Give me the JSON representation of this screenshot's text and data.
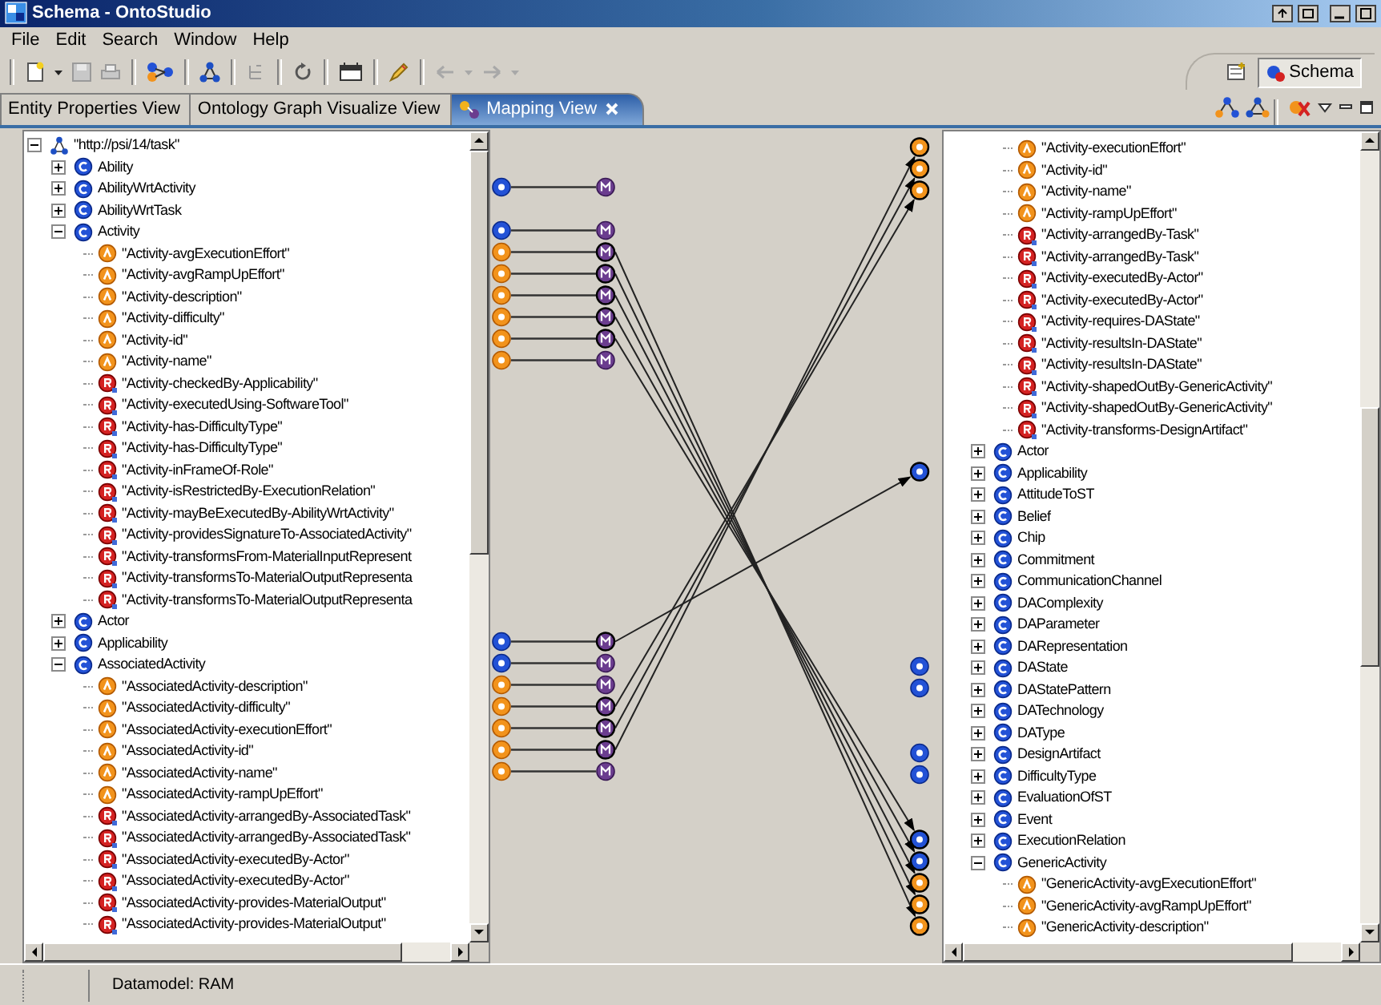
{
  "window": {
    "title": "Schema - OntoStudio"
  },
  "menu": [
    "File",
    "Edit",
    "Search",
    "Window",
    "Help"
  ],
  "perspective": {
    "label": "Schema",
    "selected": true
  },
  "tabs": [
    {
      "label": "Entity Properties View",
      "selected": false,
      "has_icon": false,
      "closable": false
    },
    {
      "label": "Ontology Graph Visualize View",
      "selected": false,
      "has_icon": false,
      "closable": false
    },
    {
      "label": "Mapping View",
      "selected": true,
      "has_icon": true,
      "closable": true
    }
  ],
  "source_tree": {
    "root": {
      "label": "\"http://psi/14/task\"",
      "kind": "ontology",
      "expanded": true,
      "children": [
        {
          "label": "Ability",
          "kind": "class",
          "expanded": false
        },
        {
          "label": "AbilityWrtActivity",
          "kind": "class",
          "expanded": false,
          "mapped": true
        },
        {
          "label": "AbilityWrtTask",
          "kind": "class",
          "expanded": false
        },
        {
          "label": "Activity",
          "kind": "class",
          "expanded": true,
          "mapped": true,
          "children": [
            {
              "label": "\"Activity-avgExecutionEffort\"",
              "kind": "attribute",
              "mapped": true,
              "arrow": true
            },
            {
              "label": "\"Activity-avgRampUpEffort\"",
              "kind": "attribute",
              "mapped": true,
              "arrow": true
            },
            {
              "label": "\"Activity-description\"",
              "kind": "attribute",
              "mapped": true,
              "arrow": true
            },
            {
              "label": "\"Activity-difficulty\"",
              "kind": "attribute",
              "mapped": true,
              "arrow": true
            },
            {
              "label": "\"Activity-id\"",
              "kind": "attribute",
              "mapped": true,
              "arrow": true
            },
            {
              "label": "\"Activity-name\"",
              "kind": "attribute",
              "mapped": true,
              "arrow": false
            },
            {
              "label": "\"Activity-checkedBy-Applicability\"",
              "kind": "relation"
            },
            {
              "label": "\"Activity-executedUsing-SoftwareTool\"",
              "kind": "relation"
            },
            {
              "label": "\"Activity-has-DifficultyType\"",
              "kind": "relation"
            },
            {
              "label": "\"Activity-has-DifficultyType\"",
              "kind": "relation"
            },
            {
              "label": "\"Activity-inFrameOf-Role\"",
              "kind": "relation"
            },
            {
              "label": "\"Activity-isRestrictedBy-ExecutionRelation\"",
              "kind": "relation"
            },
            {
              "label": "\"Activity-mayBeExecutedBy-AbilityWrtActivity\"",
              "kind": "relation"
            },
            {
              "label": "\"Activity-providesSignatureTo-AssociatedActivity\"",
              "kind": "relation"
            },
            {
              "label": "\"Activity-transformsFrom-MaterialInputRepresent",
              "kind": "relation"
            },
            {
              "label": "\"Activity-transformsTo-MaterialOutputRepresenta",
              "kind": "relation"
            },
            {
              "label": "\"Activity-transformsTo-MaterialOutputRepresenta",
              "kind": "relation"
            }
          ]
        },
        {
          "label": "Actor",
          "kind": "class",
          "expanded": false
        },
        {
          "label": "Applicability",
          "kind": "class",
          "expanded": false,
          "mapped": true,
          "arrow": true
        },
        {
          "label": "AssociatedActivity",
          "kind": "class",
          "expanded": true,
          "mapped": true,
          "children": [
            {
              "label": "\"AssociatedActivity-description\"",
              "kind": "attribute",
              "mapped": true
            },
            {
              "label": "\"AssociatedActivity-difficulty\"",
              "kind": "attribute",
              "mapped": true,
              "arrow": true
            },
            {
              "label": "\"AssociatedActivity-executionEffort\"",
              "kind": "attribute",
              "mapped": true,
              "arrow": true
            },
            {
              "label": "\"AssociatedActivity-id\"",
              "kind": "attribute",
              "mapped": true,
              "arrow": true
            },
            {
              "label": "\"AssociatedActivity-name\"",
              "kind": "attribute",
              "mapped": true
            },
            {
              "label": "\"AssociatedActivity-rampUpEffort\"",
              "kind": "attribute"
            },
            {
              "label": "\"AssociatedActivity-arrangedBy-AssociatedTask\"",
              "kind": "relation"
            },
            {
              "label": "\"AssociatedActivity-arrangedBy-AssociatedTask\"",
              "kind": "relation"
            },
            {
              "label": "\"AssociatedActivity-executedBy-Actor\"",
              "kind": "relation"
            },
            {
              "label": "\"AssociatedActivity-executedBy-Actor\"",
              "kind": "relation"
            },
            {
              "label": "\"AssociatedActivity-provides-MaterialOutput\"",
              "kind": "relation"
            },
            {
              "label": "\"AssociatedActivity-provides-MaterialOutput\"",
              "kind": "relation"
            }
          ]
        }
      ]
    }
  },
  "target_tree": {
    "continued_children": [
      {
        "label": "\"Activity-executionEffort\"",
        "kind": "attribute",
        "mapped": true,
        "arrow_in": true
      },
      {
        "label": "\"Activity-id\"",
        "kind": "attribute",
        "mapped": true,
        "arrow_in": true
      },
      {
        "label": "\"Activity-name\"",
        "kind": "attribute",
        "mapped": true,
        "arrow_in": true
      },
      {
        "label": "\"Activity-rampUpEffort\"",
        "kind": "attribute"
      },
      {
        "label": "\"Activity-arrangedBy-Task\"",
        "kind": "relation"
      },
      {
        "label": "\"Activity-arrangedBy-Task\"",
        "kind": "relation"
      },
      {
        "label": "\"Activity-executedBy-Actor\"",
        "kind": "relation"
      },
      {
        "label": "\"Activity-executedBy-Actor\"",
        "kind": "relation"
      },
      {
        "label": "\"Activity-requires-DAState\"",
        "kind": "relation"
      },
      {
        "label": "\"Activity-resultsIn-DAState\"",
        "kind": "relation"
      },
      {
        "label": "\"Activity-resultsIn-DAState\"",
        "kind": "relation"
      },
      {
        "label": "\"Activity-shapedOutBy-GenericActivity\"",
        "kind": "relation"
      },
      {
        "label": "\"Activity-shapedOutBy-GenericActivity\"",
        "kind": "relation"
      },
      {
        "label": "\"Activity-transforms-DesignArtifact\"",
        "kind": "relation"
      }
    ],
    "items": [
      {
        "label": "Actor",
        "kind": "class",
        "expanded": false
      },
      {
        "label": "Applicability",
        "kind": "class",
        "expanded": false,
        "mapped": true,
        "arrow_in": true
      },
      {
        "label": "AttitudeToST",
        "kind": "class",
        "expanded": false
      },
      {
        "label": "Belief",
        "kind": "class",
        "expanded": false
      },
      {
        "label": "Chip",
        "kind": "class",
        "expanded": false
      },
      {
        "label": "Commitment",
        "kind": "class",
        "expanded": false
      },
      {
        "label": "CommunicationChannel",
        "kind": "class",
        "expanded": false
      },
      {
        "label": "DAComplexity",
        "kind": "class",
        "expanded": false
      },
      {
        "label": "DAParameter",
        "kind": "class",
        "expanded": false
      },
      {
        "label": "DARepresentation",
        "kind": "class",
        "expanded": false
      },
      {
        "label": "DAState",
        "kind": "class",
        "expanded": false,
        "mapped": true
      },
      {
        "label": "DAStatePattern",
        "kind": "class",
        "expanded": false,
        "mapped": true
      },
      {
        "label": "DATechnology",
        "kind": "class",
        "expanded": false
      },
      {
        "label": "DAType",
        "kind": "class",
        "expanded": false
      },
      {
        "label": "DesignArtifact",
        "kind": "class",
        "expanded": false,
        "mapped": true
      },
      {
        "label": "DifficultyType",
        "kind": "class",
        "expanded": false,
        "mapped": true
      },
      {
        "label": "EvaluationOfST",
        "kind": "class",
        "expanded": false
      },
      {
        "label": "Event",
        "kind": "class",
        "expanded": false
      },
      {
        "label": "ExecutionRelation",
        "kind": "class",
        "expanded": false,
        "mapped": true,
        "arrow_in": true
      },
      {
        "label": "GenericActivity",
        "kind": "class",
        "expanded": true,
        "mapped": true,
        "arrow_in": true,
        "children": [
          {
            "label": "\"GenericActivity-avgExecutionEffort\"",
            "kind": "attribute",
            "mapped": true,
            "arrow_in": true
          },
          {
            "label": "\"GenericActivity-avgRampUpEffort\"",
            "kind": "attribute",
            "mapped": true,
            "arrow_in": true
          },
          {
            "label": "\"GenericActivity-description\"",
            "kind": "attribute",
            "mapped": true,
            "arrow_in": true
          }
        ]
      }
    ]
  },
  "status_bar": {
    "text": "Datamodel: RAM"
  }
}
